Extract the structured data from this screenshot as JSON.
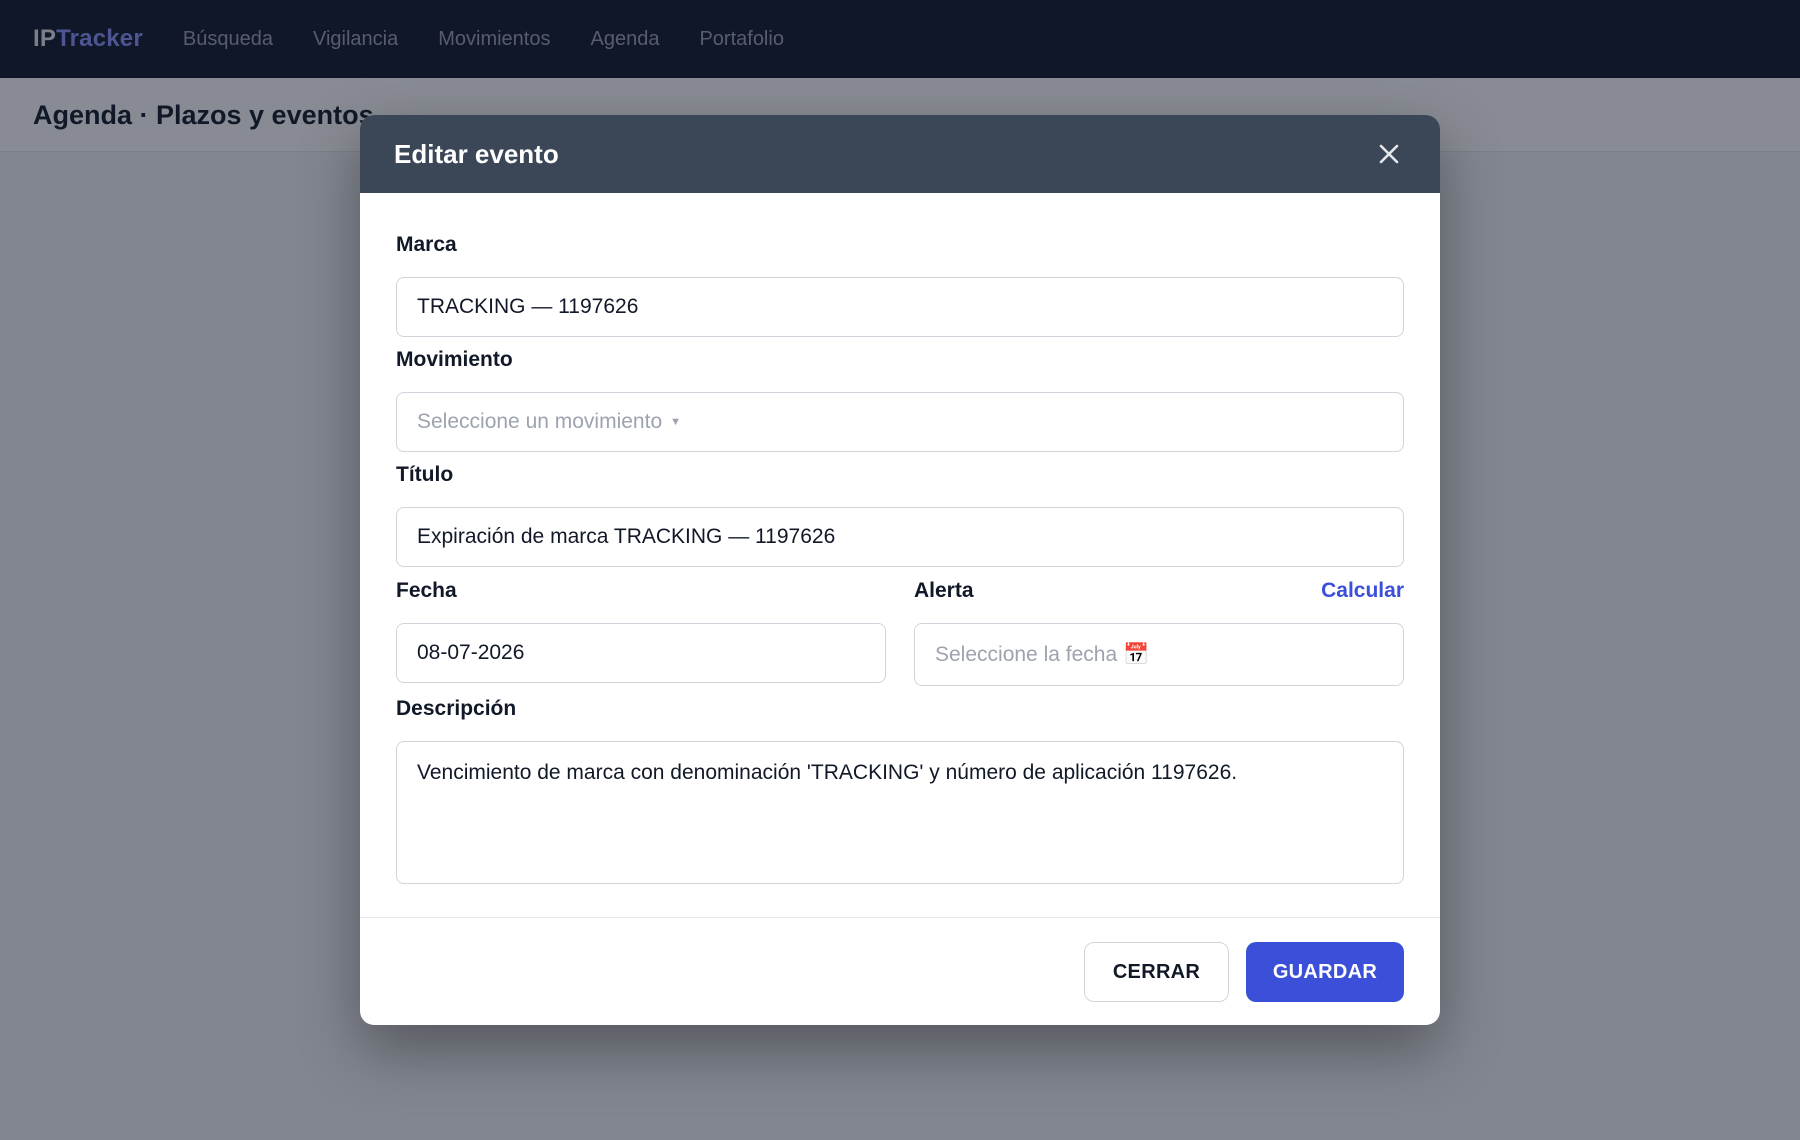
{
  "app": {
    "brand_prefix": "IP",
    "brand_suffix": "Tracker"
  },
  "nav": {
    "items": [
      {
        "label": "Búsqueda"
      },
      {
        "label": "Vigilancia"
      },
      {
        "label": "Movimientos"
      },
      {
        "label": "Agenda"
      },
      {
        "label": "Portafolio"
      }
    ]
  },
  "page": {
    "title": "Agenda · Plazos y eventos"
  },
  "modal": {
    "title": "Editar evento",
    "marca": {
      "label": "Marca",
      "value": "TRACKING — 1197626"
    },
    "movimiento": {
      "label": "Movimiento",
      "placeholder": "Seleccione un movimiento"
    },
    "titulo": {
      "label": "Título",
      "value": "Expiración de marca TRACKING — 1197626"
    },
    "fecha": {
      "label": "Fecha",
      "value": "08-07-2026"
    },
    "alerta": {
      "label": "Alerta",
      "placeholder": "Seleccione la fecha 📅",
      "calc_label": "Calcular"
    },
    "descripcion": {
      "label": "Descripción",
      "value": "Vencimiento de marca con denominación 'TRACKING' y número de aplicación 1197626."
    },
    "cancel_label": "CERRAR",
    "save_label": "GUARDAR"
  },
  "colors": {
    "accent": "#3b4fd8",
    "topbar": "#0f172a",
    "modal_header": "#3b4656"
  }
}
